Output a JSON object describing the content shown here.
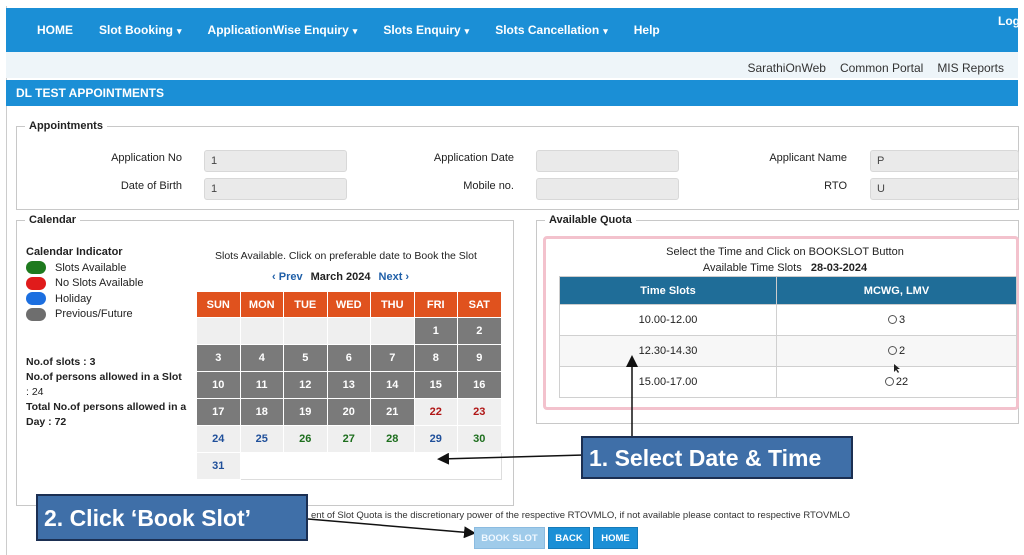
{
  "nav": {
    "home": "HOME",
    "slot_booking": "Slot Booking",
    "application_enquiry": "ApplicationWise Enquiry",
    "slots_enquiry": "Slots Enquiry",
    "slots_cancellation": "Slots Cancellation",
    "help": "Help",
    "logout": "Log",
    "caret": "▾"
  },
  "top_links": [
    "SarathiOnWeb",
    "Common Portal",
    "MIS Reports"
  ],
  "page_title": "DL TEST APPOINTMENTS",
  "appointments": {
    "legend": "Appointments",
    "application_no_label": "Application No",
    "application_no_value": "1",
    "dob_label": "Date of Birth",
    "dob_value": "1",
    "application_date_label": "Application Date",
    "application_date_value": "",
    "mobile_label": "Mobile no.",
    "mobile_value": "",
    "applicant_name_label": "Applicant Name",
    "applicant_name_value": "P",
    "rto_label": "RTO",
    "rto_value": "U"
  },
  "calendar": {
    "legend": "Calendar",
    "indicator_title": "Calendar Indicator",
    "indicators": [
      {
        "label": "Slots Available",
        "color": "#1e7a1e"
      },
      {
        "label": "No Slots Available",
        "color": "#e01b1b"
      },
      {
        "label": "Holiday",
        "color": "#1c6fe0"
      },
      {
        "label": "Previous/Future",
        "color": "#6e6e6e"
      }
    ],
    "no_of_slots": "No.of slots : 3",
    "persons_per_slot": "No.of persons allowed in a Slot",
    "persons_per_slot_value": ": 24",
    "total_persons": "Total No.of persons allowed in a",
    "total_persons_value": "Day : 72",
    "instruction": "Slots Available. Click on preferable date to Book the Slot",
    "prev": "Prev",
    "next": "Next",
    "month": "March 2024",
    "days": [
      "SUN",
      "MON",
      "TUE",
      "WED",
      "THU",
      "FRI",
      "SAT"
    ],
    "weeks": [
      [
        {
          "d": "",
          "s": "blank"
        },
        {
          "d": "",
          "s": "blank"
        },
        {
          "d": "",
          "s": "blank"
        },
        {
          "d": "",
          "s": "blank"
        },
        {
          "d": "",
          "s": "blank"
        },
        {
          "d": "1",
          "s": "past"
        },
        {
          "d": "2",
          "s": "past"
        }
      ],
      [
        {
          "d": "3",
          "s": "past"
        },
        {
          "d": "4",
          "s": "past"
        },
        {
          "d": "5",
          "s": "past"
        },
        {
          "d": "6",
          "s": "past"
        },
        {
          "d": "7",
          "s": "past"
        },
        {
          "d": "8",
          "s": "past"
        },
        {
          "d": "9",
          "s": "past"
        }
      ],
      [
        {
          "d": "10",
          "s": "past"
        },
        {
          "d": "11",
          "s": "past"
        },
        {
          "d": "12",
          "s": "past"
        },
        {
          "d": "13",
          "s": "past"
        },
        {
          "d": "14",
          "s": "past"
        },
        {
          "d": "15",
          "s": "past"
        },
        {
          "d": "16",
          "s": "past"
        }
      ],
      [
        {
          "d": "17",
          "s": "past"
        },
        {
          "d": "18",
          "s": "past"
        },
        {
          "d": "19",
          "s": "past"
        },
        {
          "d": "20",
          "s": "past"
        },
        {
          "d": "21",
          "s": "past"
        },
        {
          "d": "22",
          "s": "hol"
        },
        {
          "d": "23",
          "s": "hol"
        }
      ],
      [
        {
          "d": "24",
          "s": "avail-b"
        },
        {
          "d": "25",
          "s": "avail-b"
        },
        {
          "d": "26",
          "s": "avail-g"
        },
        {
          "d": "27",
          "s": "avail-g"
        },
        {
          "d": "28",
          "s": "avail-g"
        },
        {
          "d": "29",
          "s": "avail-b"
        },
        {
          "d": "30",
          "s": "avail-g"
        }
      ],
      [
        {
          "d": "31",
          "s": "avail-b"
        }
      ]
    ]
  },
  "quota": {
    "legend": "Available Quota",
    "instruction": "Select the Time and Click on BOOKSLOT Button",
    "available_label": "Available Time Slots",
    "available_date": "28-03-2024",
    "col_time": "Time Slots",
    "col_class": "MCWG, LMV",
    "rows": [
      {
        "time": "10.00-12.00",
        "count": "3"
      },
      {
        "time": "12.30-14.30",
        "count": "2"
      },
      {
        "time": "15.00-17.00",
        "count": "22"
      }
    ]
  },
  "callouts": {
    "select": "1. Select Date & Time",
    "book": "2. Click ‘Book Slot’"
  },
  "note": "ent of Slot Quota is the discretionary power of the respective RTOVMLO, if not available please contact to respective RTOVMLO",
  "buttons": {
    "book": "BOOK SLOT",
    "back": "BACK",
    "home": "HOME"
  }
}
